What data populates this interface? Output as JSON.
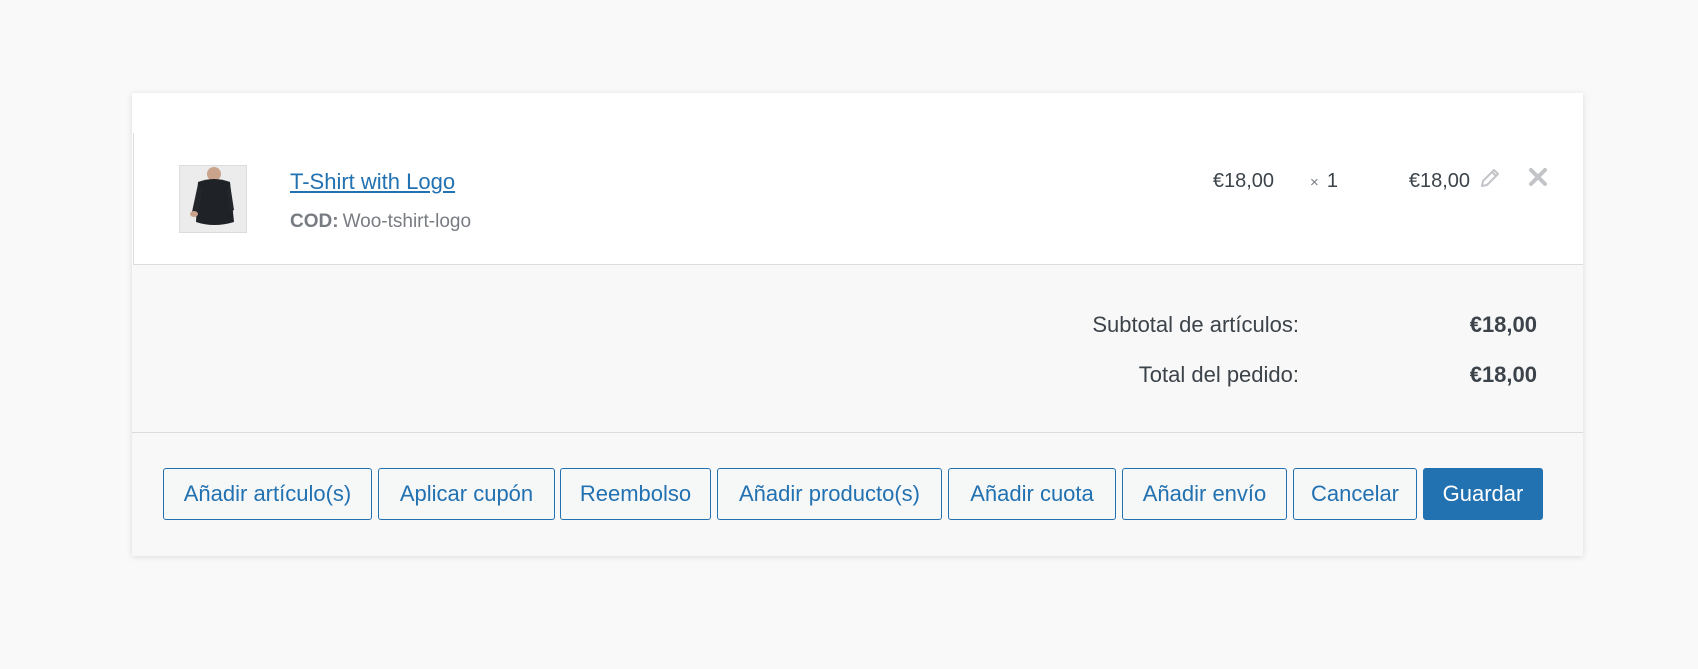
{
  "item": {
    "name": "T-Shirt with Logo",
    "sku_label": "COD:",
    "sku_value": "Woo-tshirt-logo",
    "cost": "€18,00",
    "qty_symbol": "×",
    "qty": "1",
    "total": "€18,00",
    "edit_icon": "pencil-icon",
    "delete_icon": "close-icon"
  },
  "totals": {
    "subtotal_label": "Subtotal de artículos:",
    "subtotal_value": "€18,00",
    "order_total_label": "Total del pedido:",
    "order_total_value": "€18,00"
  },
  "actions": {
    "add_items": "Añadir artículo(s)",
    "apply_coupon": "Aplicar cupón",
    "refund": "Reembolso",
    "add_products": "Añadir producto(s)",
    "add_fee": "Añadir cuota",
    "add_shipping": "Añadir envío",
    "cancel": "Cancelar",
    "save": "Guardar"
  },
  "colors": {
    "accent": "#2271b1",
    "panel_bg": "#ffffff",
    "footer_bg": "#f8f8f8",
    "page_bg": "#f9f9f9"
  }
}
